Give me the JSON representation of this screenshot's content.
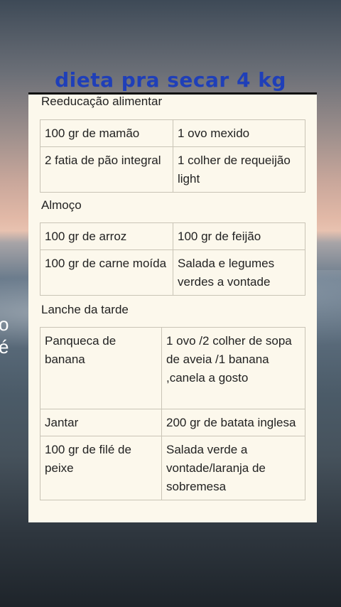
{
  "title": "dieta pra secar 4 kg",
  "edge_text": [
    "o",
    "é"
  ],
  "sections": {
    "breakfast_label": "Reeducação alimentar",
    "lunch_label": "Almoço",
    "snack_label": "Lanche da tarde"
  },
  "table1": [
    [
      "100 gr de mamão",
      "1 ovo mexido"
    ],
    [
      "2 fatia de pão integral",
      "1 colher de requeijão light"
    ]
  ],
  "table2": [
    [
      "100 gr de arroz",
      "100 gr de feijão"
    ],
    [
      "100 gr de carne moída",
      "Salada e legumes verdes a vontade"
    ]
  ],
  "table3": [
    [
      "Panqueca de banana",
      "1 ovo /2 colher de sopa de aveia /1 banana ,canela a gosto"
    ],
    [
      "Jantar",
      "200 gr de batata inglesa"
    ],
    [
      "100 gr de filé de peixe",
      "Salada verde a vontade/laranja de sobremesa"
    ]
  ]
}
